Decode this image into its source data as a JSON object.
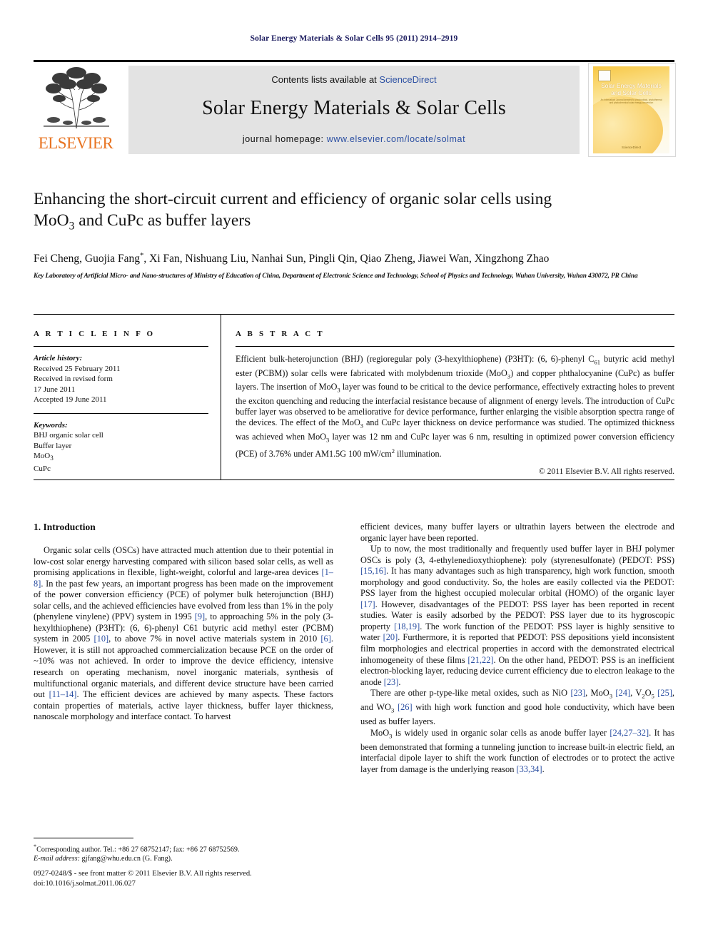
{
  "running_head": "Solar Energy Materials & Solar Cells 95 (2011) 2914–2919",
  "masthead": {
    "contents_prefix": "Contents lists available at ",
    "sciencedirect": "ScienceDirect",
    "journal_name": "Solar Energy Materials & Solar Cells",
    "homepage_prefix": "journal homepage: ",
    "homepage_url": "www.elsevier.com/locate/solmat",
    "publisher_wordmark": "ELSEVIER",
    "cover": {
      "title_line1": "Solar Energy Materials",
      "title_line2": "and Solar Cells",
      "subtitle": "An Internationl Journal devoted to photovoltaic, photothermal and photochemical solar energy conversion",
      "footer": "ScienceDirect"
    },
    "colors": {
      "elsevier_orange": "#e87422",
      "link_blue": "#2b4fa2",
      "banner_grey": "#e3e3e3"
    }
  },
  "article": {
    "title_part1": "Enhancing the short-circuit current and efficiency of organic solar cells using",
    "title_part2_pre": "MoO",
    "title_part2_sub": "3",
    "title_part2_post": " and CuPc as buffer layers",
    "authors": "Fei Cheng, Guojia Fang",
    "authors_star": "*",
    "authors_rest": ", Xi Fan, Nishuang Liu, Nanhai Sun, Pingli Qin, Qiao Zheng, Jiawei Wan, Xingzhong Zhao",
    "affiliation": "Key Laboratory of Artificial Micro- and Nano-structures of Ministry of Education of China, Department of Electronic Science and Technology, School of Physics and Technology, Wuhan University, Wuhan 430072, PR China"
  },
  "info": {
    "heading": "A R T I C L E  I N F O",
    "history_label": "Article history:",
    "history_lines": [
      "Received 25 February 2011",
      "Received in revised form",
      "17 June 2011",
      "Accepted 19 June 2011"
    ],
    "keywords_label": "Keywords:",
    "keywords": [
      "BHJ organic solar cell",
      "Buffer layer",
      "MoO3",
      "CuPc"
    ]
  },
  "abstract": {
    "heading": "A B S T R A C T",
    "text_1": "Efficient bulk-heterojunction (BHJ) (regioregular poly (3-hexylthiophene) (P3HT): (6, 6)-phenyl C",
    "text_1_sub": "61",
    "text_2": " butyric acid methyl ester (PCBM)) solar cells were fabricated with molybdenum trioxide (MoO",
    "text_2_sub": "3",
    "text_3": ") and copper phthalocyanine (CuPc) as buffer layers. The insertion of MoO",
    "text_3_sub": "3",
    "text_4": " layer was found to be critical to the device performance, effectively extracting holes to prevent the exciton quenching and reducing the interfacial resistance because of alignment of energy levels. The introduction of CuPc buffer layer was observed to be ameliorative for device performance, further enlarging the visible absorption spectra range of the devices. The effect of the MoO",
    "text_4_sub": "3",
    "text_5": " and CuPc layer thickness on device performance was studied. The optimized thickness was achieved when MoO",
    "text_5_sub": "3",
    "text_6": " layer was 12 nm and CuPc layer was 6 nm, resulting in optimized power conversion efficiency (PCE) of 3.76% under AM1.5G 100 mW/cm",
    "text_6_sup": "2",
    "text_7": " illumination.",
    "copyright": "© 2011 Elsevier B.V. All rights reserved."
  },
  "body": {
    "section_number_title": "1.  Introduction",
    "left_p1_a": "Organic solar cells (OSCs) have attracted much attention due to their potential in low-cost solar energy harvesting compared with silicon based solar cells, as well as promising applications in flexible, light-weight, colorful and large-area devices ",
    "left_p1_ref1": "[1–8]",
    "left_p1_b": ". In the past few years, an important progress has been made on the improvement of the power conversion efficiency (PCE) of polymer bulk heterojunction (BHJ) solar cells, and the achieved efficiencies have evolved from less than 1% in the poly (phenylene vinylene) (PPV) system in 1995 ",
    "left_p1_ref2": "[9]",
    "left_p1_c": ", to approaching 5% in the poly (3-hexylthiophene) (P3HT): (6, 6)-phenyl C61 butyric acid methyl ester (PCBM) system in 2005 ",
    "left_p1_ref3": "[10]",
    "left_p1_d": ", to above 7% in novel active materials system in 2010 ",
    "left_p1_ref4": "[6]",
    "left_p1_e": ". However, it is still not approached commercialization because PCE on the order of ~10% was not achieved. In order to improve the device efficiency, intensive research on operating mechanism, novel inorganic materials, synthesis of multifunctional organic materials, and different device structure have been carried out ",
    "left_p1_ref5": "[11–14]",
    "left_p1_f": ". The efficient devices are achieved by many aspects. These factors contain properties of materials, active layer thickness, buffer layer thickness, nanoscale morphology and interface contact. To harvest",
    "right_p1": "efficient devices, many buffer layers or ultrathin layers between the electrode and organic layer have been reported.",
    "right_p2_a": "Up to now, the most traditionally and frequently used buffer layer in BHJ polymer OSCs is poly (3, 4-ethylenedioxythiophene): poly (styrenesulfonate) (PEDOT: PSS) ",
    "right_p2_ref1": "[15,16]",
    "right_p2_b": ". It has many advantages such as high transparency, high work function, smooth morphology and good conductivity. So, the holes are easily collected via the PEDOT: PSS layer from the highest occupied molecular orbital (HOMO) of the organic layer ",
    "right_p2_ref2": "[17]",
    "right_p2_c": ". However, disadvantages of the PEDOT: PSS layer has been reported in recent studies. Water is easily adsorbed by the PEDOT: PSS layer due to its hygroscopic property ",
    "right_p2_ref3": "[18,19]",
    "right_p2_d": ". The work function of the PEDOT: PSS layer is highly sensitive to water ",
    "right_p2_ref4": "[20]",
    "right_p2_e": ". Furthermore, it is reported that PEDOT: PSS depositions yield inconsistent film morphologies and electrical properties in accord with the demonstrated electrical inhomogeneity of these films ",
    "right_p2_ref5": "[21,22]",
    "right_p2_f": ". On the other hand, PEDOT: PSS is an inefficient electron-blocking layer, reducing device current efficiency due to electron leakage to the anode ",
    "right_p2_ref6": "[23]",
    "right_p2_g": ".",
    "right_p3_a": "There are other p-type-like metal oxides, such as NiO ",
    "right_p3_ref1": "[23]",
    "right_p3_b": ", MoO",
    "right_p3_sub1": "3",
    "right_p3_c": " ",
    "right_p3_ref2": "[24]",
    "right_p3_d": ", V",
    "right_p3_sub2": "2",
    "right_p3_e": "O",
    "right_p3_sub3": "5",
    "right_p3_f": " ",
    "right_p3_ref3": "[25]",
    "right_p3_g": ", and WO",
    "right_p3_sub4": "3",
    "right_p3_h": " ",
    "right_p3_ref4": "[26]",
    "right_p3_i": " with high work function and good hole conductivity, which have been used as buffer layers.",
    "right_p4_a": "MoO",
    "right_p4_sub1": "3",
    "right_p4_b": " is widely used in organic solar cells as anode buffer layer ",
    "right_p4_ref1": "[24,27–32]",
    "right_p4_c": ". It has been demonstrated that forming a tunneling junction to increase built-in electric field, an interfacial dipole layer to shift the work function of electrodes or to protect the active layer from damage is the underlying reason ",
    "right_p4_ref2": "[33,34]",
    "right_p4_d": "."
  },
  "footnote": {
    "corresponding": "Corresponding author. Tel.: +86 27 68752147; fax: +86 27 68752569.",
    "email_label": "E-mail address:",
    "email": " gjfang@whu.edu.cn (G. Fang)."
  },
  "footer": {
    "issn_line": "0927-0248/$ - see front matter © 2011 Elsevier B.V. All rights reserved.",
    "doi_line": "doi:10.1016/j.solmat.2011.06.027"
  }
}
